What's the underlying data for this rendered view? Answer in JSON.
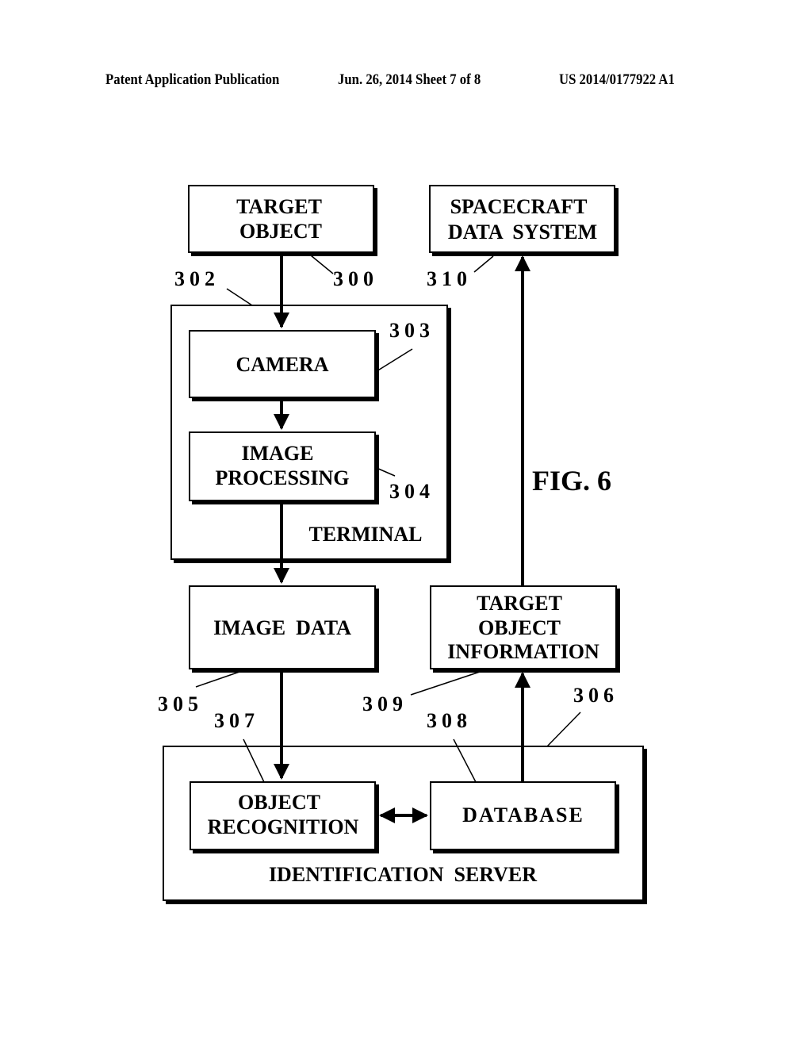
{
  "header": {
    "left": "Patent Application Publication",
    "middle": "Jun. 26, 2014  Sheet 7 of 8",
    "right": "US 2014/0177922 A1"
  },
  "figure_label": "FIG. 6",
  "boxes": {
    "target_object": [
      "TARGET",
      "OBJECT"
    ],
    "spacecraft_data_system": [
      "SPACECRAFT",
      "DATA  SYSTEM"
    ],
    "camera": [
      "CAMERA"
    ],
    "image_processing": [
      "IMAGE",
      "PROCESSING"
    ],
    "terminal": "TERMINAL",
    "image_data": [
      "IMAGE  DATA"
    ],
    "target_object_information": [
      "TARGET",
      "OBJECT",
      "INFORMATION"
    ],
    "object_recognition": [
      "OBJECT",
      "RECOGNITION"
    ],
    "database": [
      "DATABASE"
    ],
    "identification_server": "IDENTIFICATION  SERVER"
  },
  "refs": {
    "r300": "300",
    "r302": "302",
    "r303": "303",
    "r304": "304",
    "r305": "305",
    "r306": "306",
    "r307": "307",
    "r308": "308",
    "r309": "309",
    "r310": "310"
  }
}
